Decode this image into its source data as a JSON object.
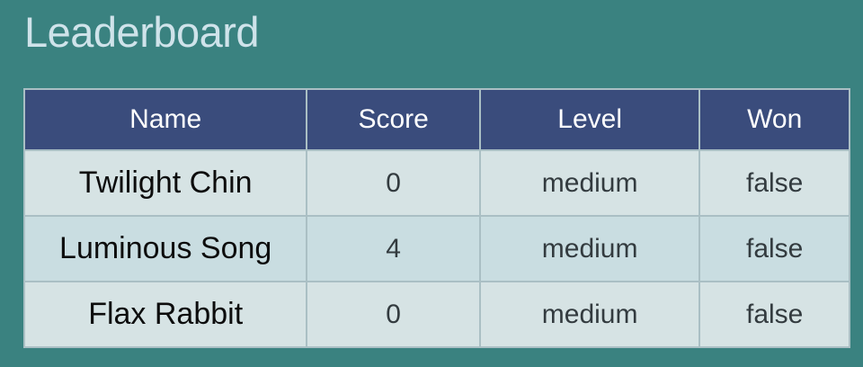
{
  "title": "Leaderboard",
  "table": {
    "headers": [
      "Name",
      "Score",
      "Level",
      "Won"
    ],
    "rows": [
      {
        "name": "Twilight Chin",
        "score": "0",
        "level": "medium",
        "won": "false"
      },
      {
        "name": "Luminous Song",
        "score": "4",
        "level": "medium",
        "won": "false"
      },
      {
        "name": "Flax Rabbit",
        "score": "0",
        "level": "medium",
        "won": "false"
      }
    ]
  },
  "colors": {
    "background": "#3a8280",
    "header_bg": "#3a4c7c",
    "row_light": "#d6e3e4",
    "row_alt": "#c9dde1",
    "title_text": "#cfe3ea"
  }
}
